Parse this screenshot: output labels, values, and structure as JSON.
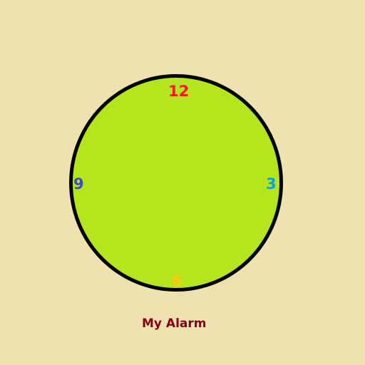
{
  "clock": {
    "hour_labels": {
      "twelve": "12",
      "three": "3",
      "six": "6",
      "nine": "9"
    },
    "colors": {
      "background": "#efe2b1",
      "face": "#b5e51d",
      "rim": "#000000",
      "twelve": "#ed1c24",
      "three": "#00a2e8",
      "six": "#ffc90e",
      "nine": "#3f48cc"
    }
  },
  "title": {
    "text": "My Alarm",
    "color": "#880015"
  }
}
